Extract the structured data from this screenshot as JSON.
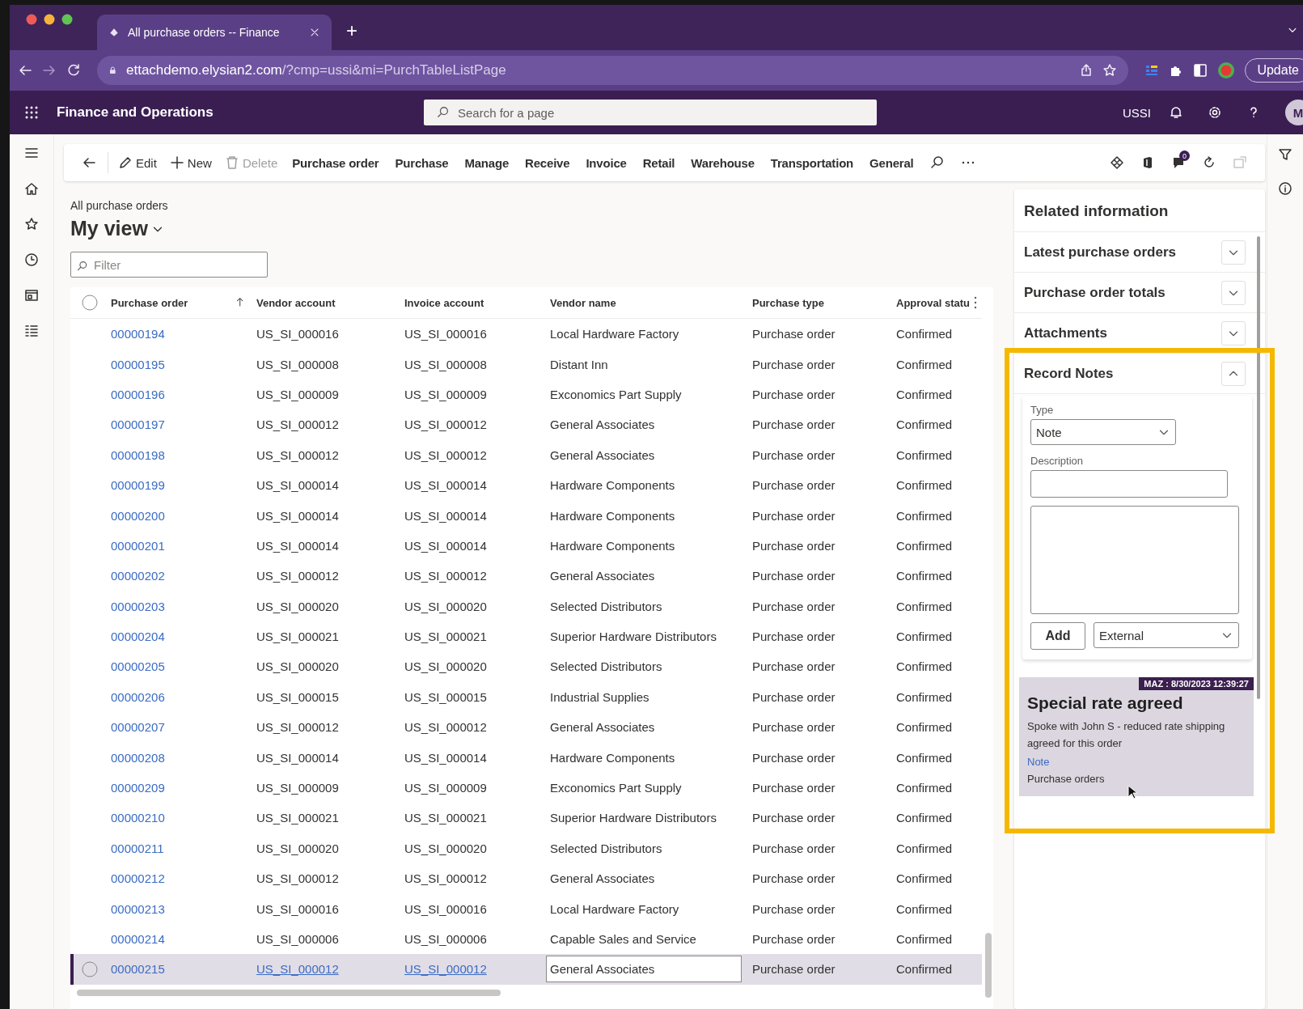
{
  "browser": {
    "tab_title": "All purchase orders -- Finance",
    "new_tab": "+",
    "url_host": "ettachdemo.elysian2.com",
    "url_path": "/?cmp=ussi&mi=PurchTableListPage",
    "update_button": "Update"
  },
  "app_header": {
    "title": "Finance and Operations",
    "search": {
      "placeholder": "Search for a page"
    },
    "company": "USSI",
    "avatar": "M"
  },
  "toolbar": {
    "actions": [
      {
        "label": "Edit",
        "disabled": false
      },
      {
        "label": "New",
        "disabled": false
      },
      {
        "label": "Delete",
        "disabled": true
      }
    ],
    "menus": [
      "Purchase order",
      "Purchase",
      "Manage",
      "Receive",
      "Invoice",
      "Retail",
      "Warehouse",
      "Transportation",
      "General"
    ],
    "notification_count": "0"
  },
  "page": {
    "breadcrumb": "All purchase orders",
    "view_title": "My view",
    "filter": {
      "placeholder": "Filter"
    }
  },
  "table": {
    "select_all_checked": false,
    "columns": [
      "Purchase order",
      "Vendor account",
      "Invoice account",
      "Vendor name",
      "Purchase type",
      "Approval statu"
    ],
    "rows": [
      {
        "cells": [
          "00000194",
          "US_SI_000016",
          "US_SI_000016",
          "Local Hardware Factory",
          "Purchase order",
          "Confirmed"
        ],
        "selected": false
      },
      {
        "cells": [
          "00000195",
          "US_SI_000008",
          "US_SI_000008",
          "Distant Inn",
          "Purchase order",
          "Confirmed"
        ],
        "selected": false
      },
      {
        "cells": [
          "00000196",
          "US_SI_000009",
          "US_SI_000009",
          "Exconomics Part Supply",
          "Purchase order",
          "Confirmed"
        ],
        "selected": false
      },
      {
        "cells": [
          "00000197",
          "US_SI_000012",
          "US_SI_000012",
          "General Associates",
          "Purchase order",
          "Confirmed"
        ],
        "selected": false
      },
      {
        "cells": [
          "00000198",
          "US_SI_000012",
          "US_SI_000012",
          "General Associates",
          "Purchase order",
          "Confirmed"
        ],
        "selected": false
      },
      {
        "cells": [
          "00000199",
          "US_SI_000014",
          "US_SI_000014",
          "Hardware Components",
          "Purchase order",
          "Confirmed"
        ],
        "selected": false
      },
      {
        "cells": [
          "00000200",
          "US_SI_000014",
          "US_SI_000014",
          "Hardware Components",
          "Purchase order",
          "Confirmed"
        ],
        "selected": false
      },
      {
        "cells": [
          "00000201",
          "US_SI_000014",
          "US_SI_000014",
          "Hardware Components",
          "Purchase order",
          "Confirmed"
        ],
        "selected": false
      },
      {
        "cells": [
          "00000202",
          "US_SI_000012",
          "US_SI_000012",
          "General Associates",
          "Purchase order",
          "Confirmed"
        ],
        "selected": false
      },
      {
        "cells": [
          "00000203",
          "US_SI_000020",
          "US_SI_000020",
          "Selected Distributors",
          "Purchase order",
          "Confirmed"
        ],
        "selected": false
      },
      {
        "cells": [
          "00000204",
          "US_SI_000021",
          "US_SI_000021",
          "Superior Hardware Distributors",
          "Purchase order",
          "Confirmed"
        ],
        "selected": false
      },
      {
        "cells": [
          "00000205",
          "US_SI_000020",
          "US_SI_000020",
          "Selected Distributors",
          "Purchase order",
          "Confirmed"
        ],
        "selected": false
      },
      {
        "cells": [
          "00000206",
          "US_SI_000015",
          "US_SI_000015",
          "Industrial Supplies",
          "Purchase order",
          "Confirmed"
        ],
        "selected": false
      },
      {
        "cells": [
          "00000207",
          "US_SI_000012",
          "US_SI_000012",
          "General Associates",
          "Purchase order",
          "Confirmed"
        ],
        "selected": false
      },
      {
        "cells": [
          "00000208",
          "US_SI_000014",
          "US_SI_000014",
          "Hardware Components",
          "Purchase order",
          "Confirmed"
        ],
        "selected": false
      },
      {
        "cells": [
          "00000209",
          "US_SI_000009",
          "US_SI_000009",
          "Exconomics Part Supply",
          "Purchase order",
          "Confirmed"
        ],
        "selected": false
      },
      {
        "cells": [
          "00000210",
          "US_SI_000021",
          "US_SI_000021",
          "Superior Hardware Distributors",
          "Purchase order",
          "Confirmed"
        ],
        "selected": false
      },
      {
        "cells": [
          "00000211",
          "US_SI_000020",
          "US_SI_000020",
          "Selected Distributors",
          "Purchase order",
          "Confirmed"
        ],
        "selected": false
      },
      {
        "cells": [
          "00000212",
          "US_SI_000012",
          "US_SI_000012",
          "General Associates",
          "Purchase order",
          "Confirmed"
        ],
        "selected": false
      },
      {
        "cells": [
          "00000213",
          "US_SI_000016",
          "US_SI_000016",
          "Local Hardware Factory",
          "Purchase order",
          "Confirmed"
        ],
        "selected": false
      },
      {
        "cells": [
          "00000214",
          "US_SI_000006",
          "US_SI_000006",
          "Capable Sales and Service",
          "Purchase order",
          "Confirmed"
        ],
        "selected": false
      },
      {
        "cells": [
          "00000215",
          "US_SI_000012",
          "US_SI_000012",
          "General Associates",
          "Purchase order",
          "Confirmed"
        ],
        "selected": true
      }
    ]
  },
  "related_panel": {
    "title": "Related information",
    "sections": [
      {
        "title": "Latest purchase orders",
        "expanded": false
      },
      {
        "title": "Purchase order totals",
        "expanded": false
      },
      {
        "title": "Attachments",
        "expanded": false
      },
      {
        "title": "Record Notes",
        "expanded": true
      }
    ],
    "note_form": {
      "type_label": "Type",
      "type_value": "Note",
      "description_label": "Description",
      "add_button": "Add",
      "visibility": "External"
    },
    "note": {
      "stamp": "MAZ : 8/30/2023 12:39:27",
      "title": "Special rate agreed",
      "body": "Spoke with John S - reduced rate shipping agreed for this order",
      "type_link": "Note",
      "source": "Purchase orders"
    }
  }
}
